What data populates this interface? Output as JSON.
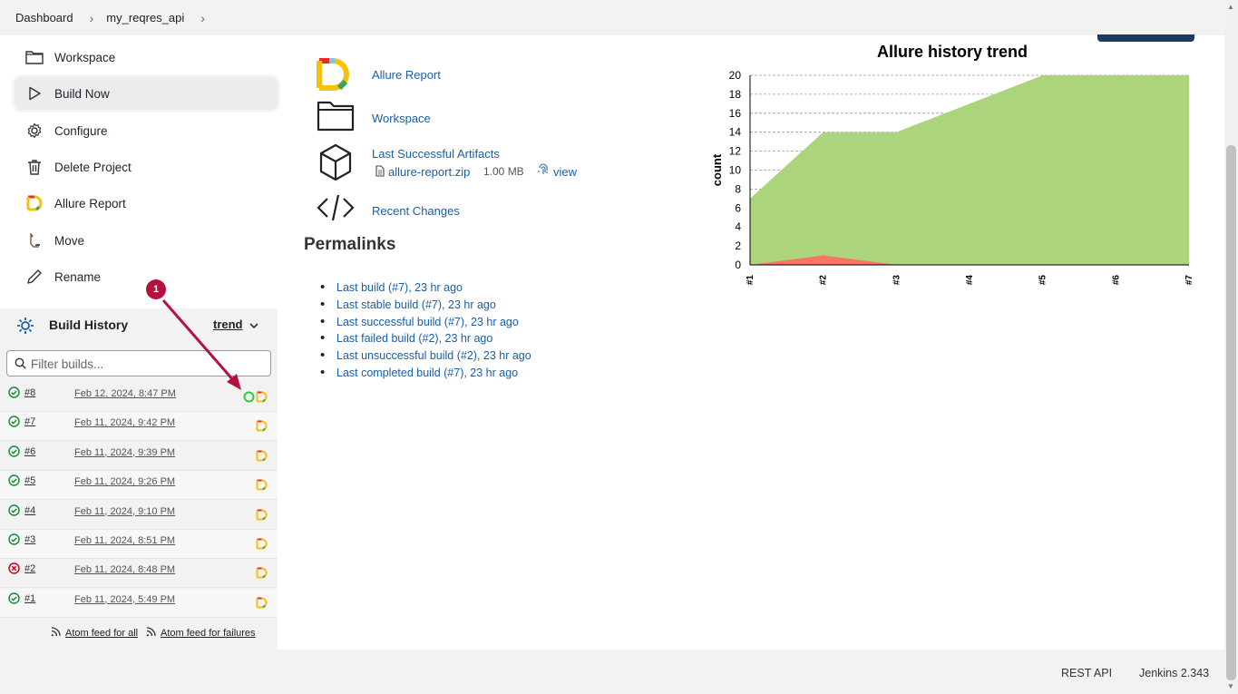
{
  "breadcrumb": {
    "items": [
      "Dashboard",
      "my_reqres_api"
    ]
  },
  "sidebar": {
    "tasks": [
      {
        "label": "Workspace"
      },
      {
        "label": "Build Now"
      },
      {
        "label": "Configure"
      },
      {
        "label": "Delete Project"
      },
      {
        "label": "Allure Report"
      },
      {
        "label": "Move"
      },
      {
        "label": "Rename"
      }
    ]
  },
  "build_history": {
    "title": "Build History",
    "trend_label": "trend",
    "filter_placeholder": "Filter builds...",
    "builds": [
      {
        "number": "#8",
        "date": "Feb 12, 2024, 8:47 PM",
        "status": "success"
      },
      {
        "number": "#7",
        "date": "Feb 11, 2024, 9:42 PM",
        "status": "success"
      },
      {
        "number": "#6",
        "date": "Feb 11, 2024, 9:39 PM",
        "status": "success"
      },
      {
        "number": "#5",
        "date": "Feb 11, 2024, 9:26 PM",
        "status": "success"
      },
      {
        "number": "#4",
        "date": "Feb 11, 2024, 9:10 PM",
        "status": "success"
      },
      {
        "number": "#3",
        "date": "Feb 11, 2024, 8:51 PM",
        "status": "success"
      },
      {
        "number": "#2",
        "date": "Feb 11, 2024, 8:48 PM",
        "status": "failed"
      },
      {
        "number": "#1",
        "date": "Feb 11, 2024, 5:49 PM",
        "status": "success"
      }
    ],
    "atom_all": "Atom feed for all",
    "atom_failures": "Atom feed for failures"
  },
  "main": {
    "links": {
      "allure_report": "Allure Report",
      "workspace": "Workspace",
      "last_successful_artifacts": "Last Successful Artifacts",
      "artifact_file": "allure-report.zip",
      "artifact_size": "1.00 MB",
      "artifact_view": "view",
      "recent_changes": "Recent Changes"
    },
    "permalinks_title": "Permalinks",
    "permalinks": [
      "Last build (#7), 23 hr ago",
      "Last stable build (#7), 23 hr ago",
      "Last successful build (#7), 23 hr ago",
      "Last failed build (#2), 23 hr ago",
      "Last unsuccessful build (#2), 23 hr ago",
      "Last completed build (#7), 23 hr ago"
    ]
  },
  "annotation": {
    "badge": "1"
  },
  "footer": {
    "rest_api": "REST API",
    "version": "Jenkins 2.343"
  },
  "colors": {
    "passed": "#acd47c",
    "failed": "#fa7461",
    "success_icon": "#138a36",
    "failed_icon": "#c4001e",
    "link": "#1a5ea8",
    "annotation": "#b3123e"
  },
  "chart_data": {
    "type": "area",
    "title": "Allure history trend",
    "xlabel": "",
    "ylabel": "count",
    "categories": [
      "#1",
      "#2",
      "#3",
      "#4",
      "#5",
      "#6",
      "#7"
    ],
    "series": [
      {
        "color": "#fa7461",
        "values": [
          0,
          1,
          0,
          0,
          0,
          0,
          0
        ]
      },
      {
        "color": "#acd47c",
        "values": [
          7,
          13,
          14,
          17,
          20,
          20,
          20
        ]
      }
    ],
    "ylim": [
      0,
      20
    ],
    "yticks": [
      0,
      2,
      4,
      6,
      8,
      10,
      12,
      14,
      16,
      18,
      20
    ],
    "stacked": true,
    "grid": true
  }
}
